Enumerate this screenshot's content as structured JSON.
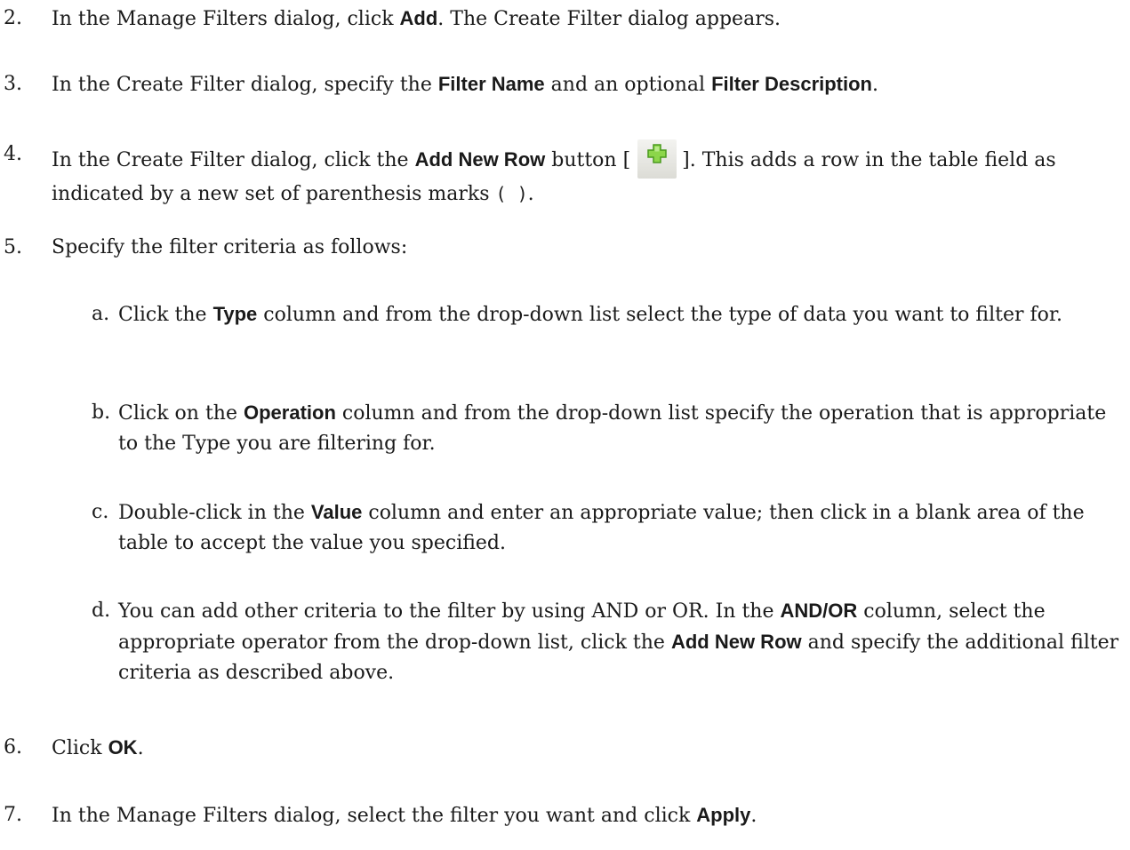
{
  "steps": [
    {
      "num": "2.",
      "t1": "In the Manage Filters dialog, click ",
      "b1": "Add",
      "t2": ". The Create Filter dialog appears."
    },
    {
      "num": "3.",
      "t1": "In the Create Filter dialog, specify the ",
      "b1": "Filter Name",
      "t2": " and an optional ",
      "b2": "Filter Description",
      "t3": "."
    },
    {
      "num": "4.",
      "t1": "In the Create Filter dialog, click the ",
      "b1": "Add New Row",
      "t2": " button [",
      "icon": "add-row-plus-icon",
      "t3": "]. This adds a row in the table field as indicated by a new set of parenthesis marks ",
      "code": "( )",
      "t4": "."
    },
    {
      "num": "5.",
      "t1": "Specify the filter criteria as follows:"
    },
    {
      "num": "6.",
      "t1": "Click ",
      "b1": "OK",
      "t2": "."
    },
    {
      "num": "7.",
      "t1": "In the Manage Filters dialog, select the filter you want and click ",
      "b1": "Apply",
      "t2": "."
    }
  ],
  "substeps": [
    {
      "num": "a.",
      "t1": "Click the ",
      "b1": "Type",
      "t2": " column and from the drop-down list select the type of data you want to filter for."
    },
    {
      "num": "b.",
      "t1": "Click on the ",
      "b1": "Operation",
      "t2": " column and from the drop-down list specify the operation that is appropriate to the Type you are filtering for."
    },
    {
      "num": "c.",
      "t1": "Double-click in the ",
      "b1": "Value",
      "t2": " column and enter an appropriate value; then click in a blank area of the table to accept the value you specified."
    },
    {
      "num": "d.",
      "t1": "You can add other criteria to the filter by using AND or OR. In the ",
      "b1": "AND/OR",
      "t2": " column, select the appropriate operator from the drop-down list, click the ",
      "b2": "Add New Row",
      "t3": " and specify the additional filter criteria as described above."
    }
  ],
  "colors": {
    "text": "#1a1a1a",
    "icon_plus_fill": "#8cd64a",
    "icon_plus_stroke": "#4a9a1e",
    "icon_button_bg": "#e6e6e1"
  }
}
